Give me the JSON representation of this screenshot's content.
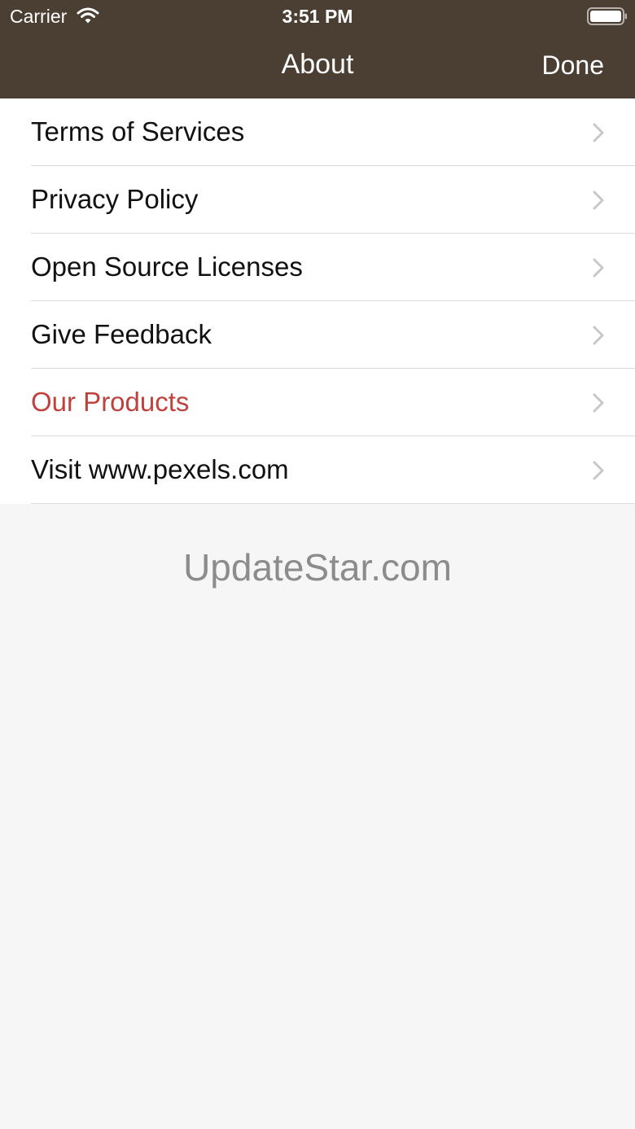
{
  "status_bar": {
    "carrier": "Carrier",
    "time": "3:51 PM",
    "wifi_icon": "wifi-icon",
    "battery_icon": "battery-icon"
  },
  "nav": {
    "title": "About",
    "done_label": "Done",
    "bar_color": "#4b3e33"
  },
  "menu": {
    "items": [
      {
        "label": "Terms of Services"
      },
      {
        "label": "Privacy Policy"
      },
      {
        "label": "Open Source Licenses"
      },
      {
        "label": "Give Feedback"
      },
      {
        "label": "Our Products",
        "color": "#c0423e"
      },
      {
        "label": "Visit www.pexels.com"
      }
    ],
    "chevron_icon": "chevron-right-icon"
  },
  "watermark": {
    "text": "UpdateStar.com"
  }
}
